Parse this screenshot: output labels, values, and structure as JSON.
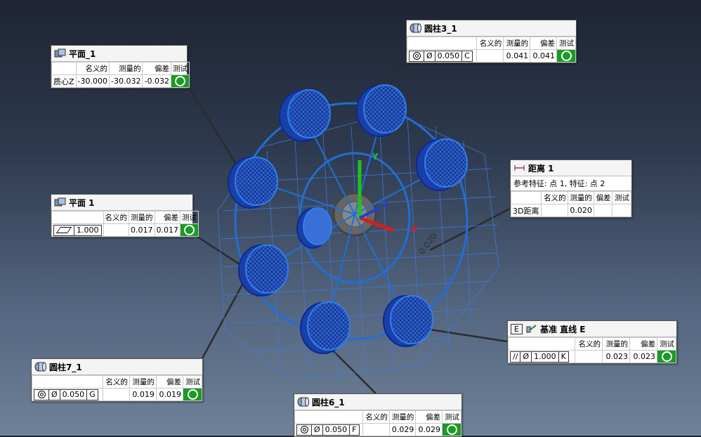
{
  "scene": {
    "axes": {
      "x": "X",
      "y": "Y",
      "z": "Z"
    },
    "distance_annotation": "0.020"
  },
  "columns": {
    "nominal": "名义的",
    "measured": "测量的",
    "deviation": "偏差",
    "test": "测试"
  },
  "panels": {
    "plane_1": {
      "title": "平面_1",
      "row_label": "质心Z",
      "nominal": "-30.000",
      "measured": "-30.032",
      "deviation": "-0.032"
    },
    "plane_flat": {
      "title": "平面 1",
      "tolerance": "1.000",
      "measured": "0.017",
      "deviation": "0.017"
    },
    "cyl_3": {
      "title": "圆柱3_1",
      "diameter_symbol": "Ø",
      "tolerance": "0.050",
      "datum": "C",
      "measured": "0.041",
      "deviation": "0.041"
    },
    "distance_1": {
      "title": "距离 1",
      "subtitle": "参考特征: 点 1, 特征: 点 2",
      "row_label": "3D距离",
      "measured": "0.020"
    },
    "datum_e": {
      "title": "基准 直线 E",
      "datum_box": "E",
      "parallel_symbol": "//",
      "diameter_symbol": "Ø",
      "tolerance": "1.000",
      "datum": "K",
      "measured": "0.023",
      "deviation": "0.023"
    },
    "cyl_7": {
      "title": "圆柱7_1",
      "diameter_symbol": "Ø",
      "tolerance": "0.050",
      "datum": "G",
      "measured": "0.019",
      "deviation": "0.019"
    },
    "cyl_6": {
      "title": "圆柱6_1",
      "diameter_symbol": "Ø",
      "tolerance": "0.050",
      "datum": "F",
      "measured": "0.029",
      "deviation": "0.029"
    }
  },
  "colors": {
    "pass": "#1b9a24",
    "part": "#1f6fd6",
    "leader": "#333333"
  }
}
